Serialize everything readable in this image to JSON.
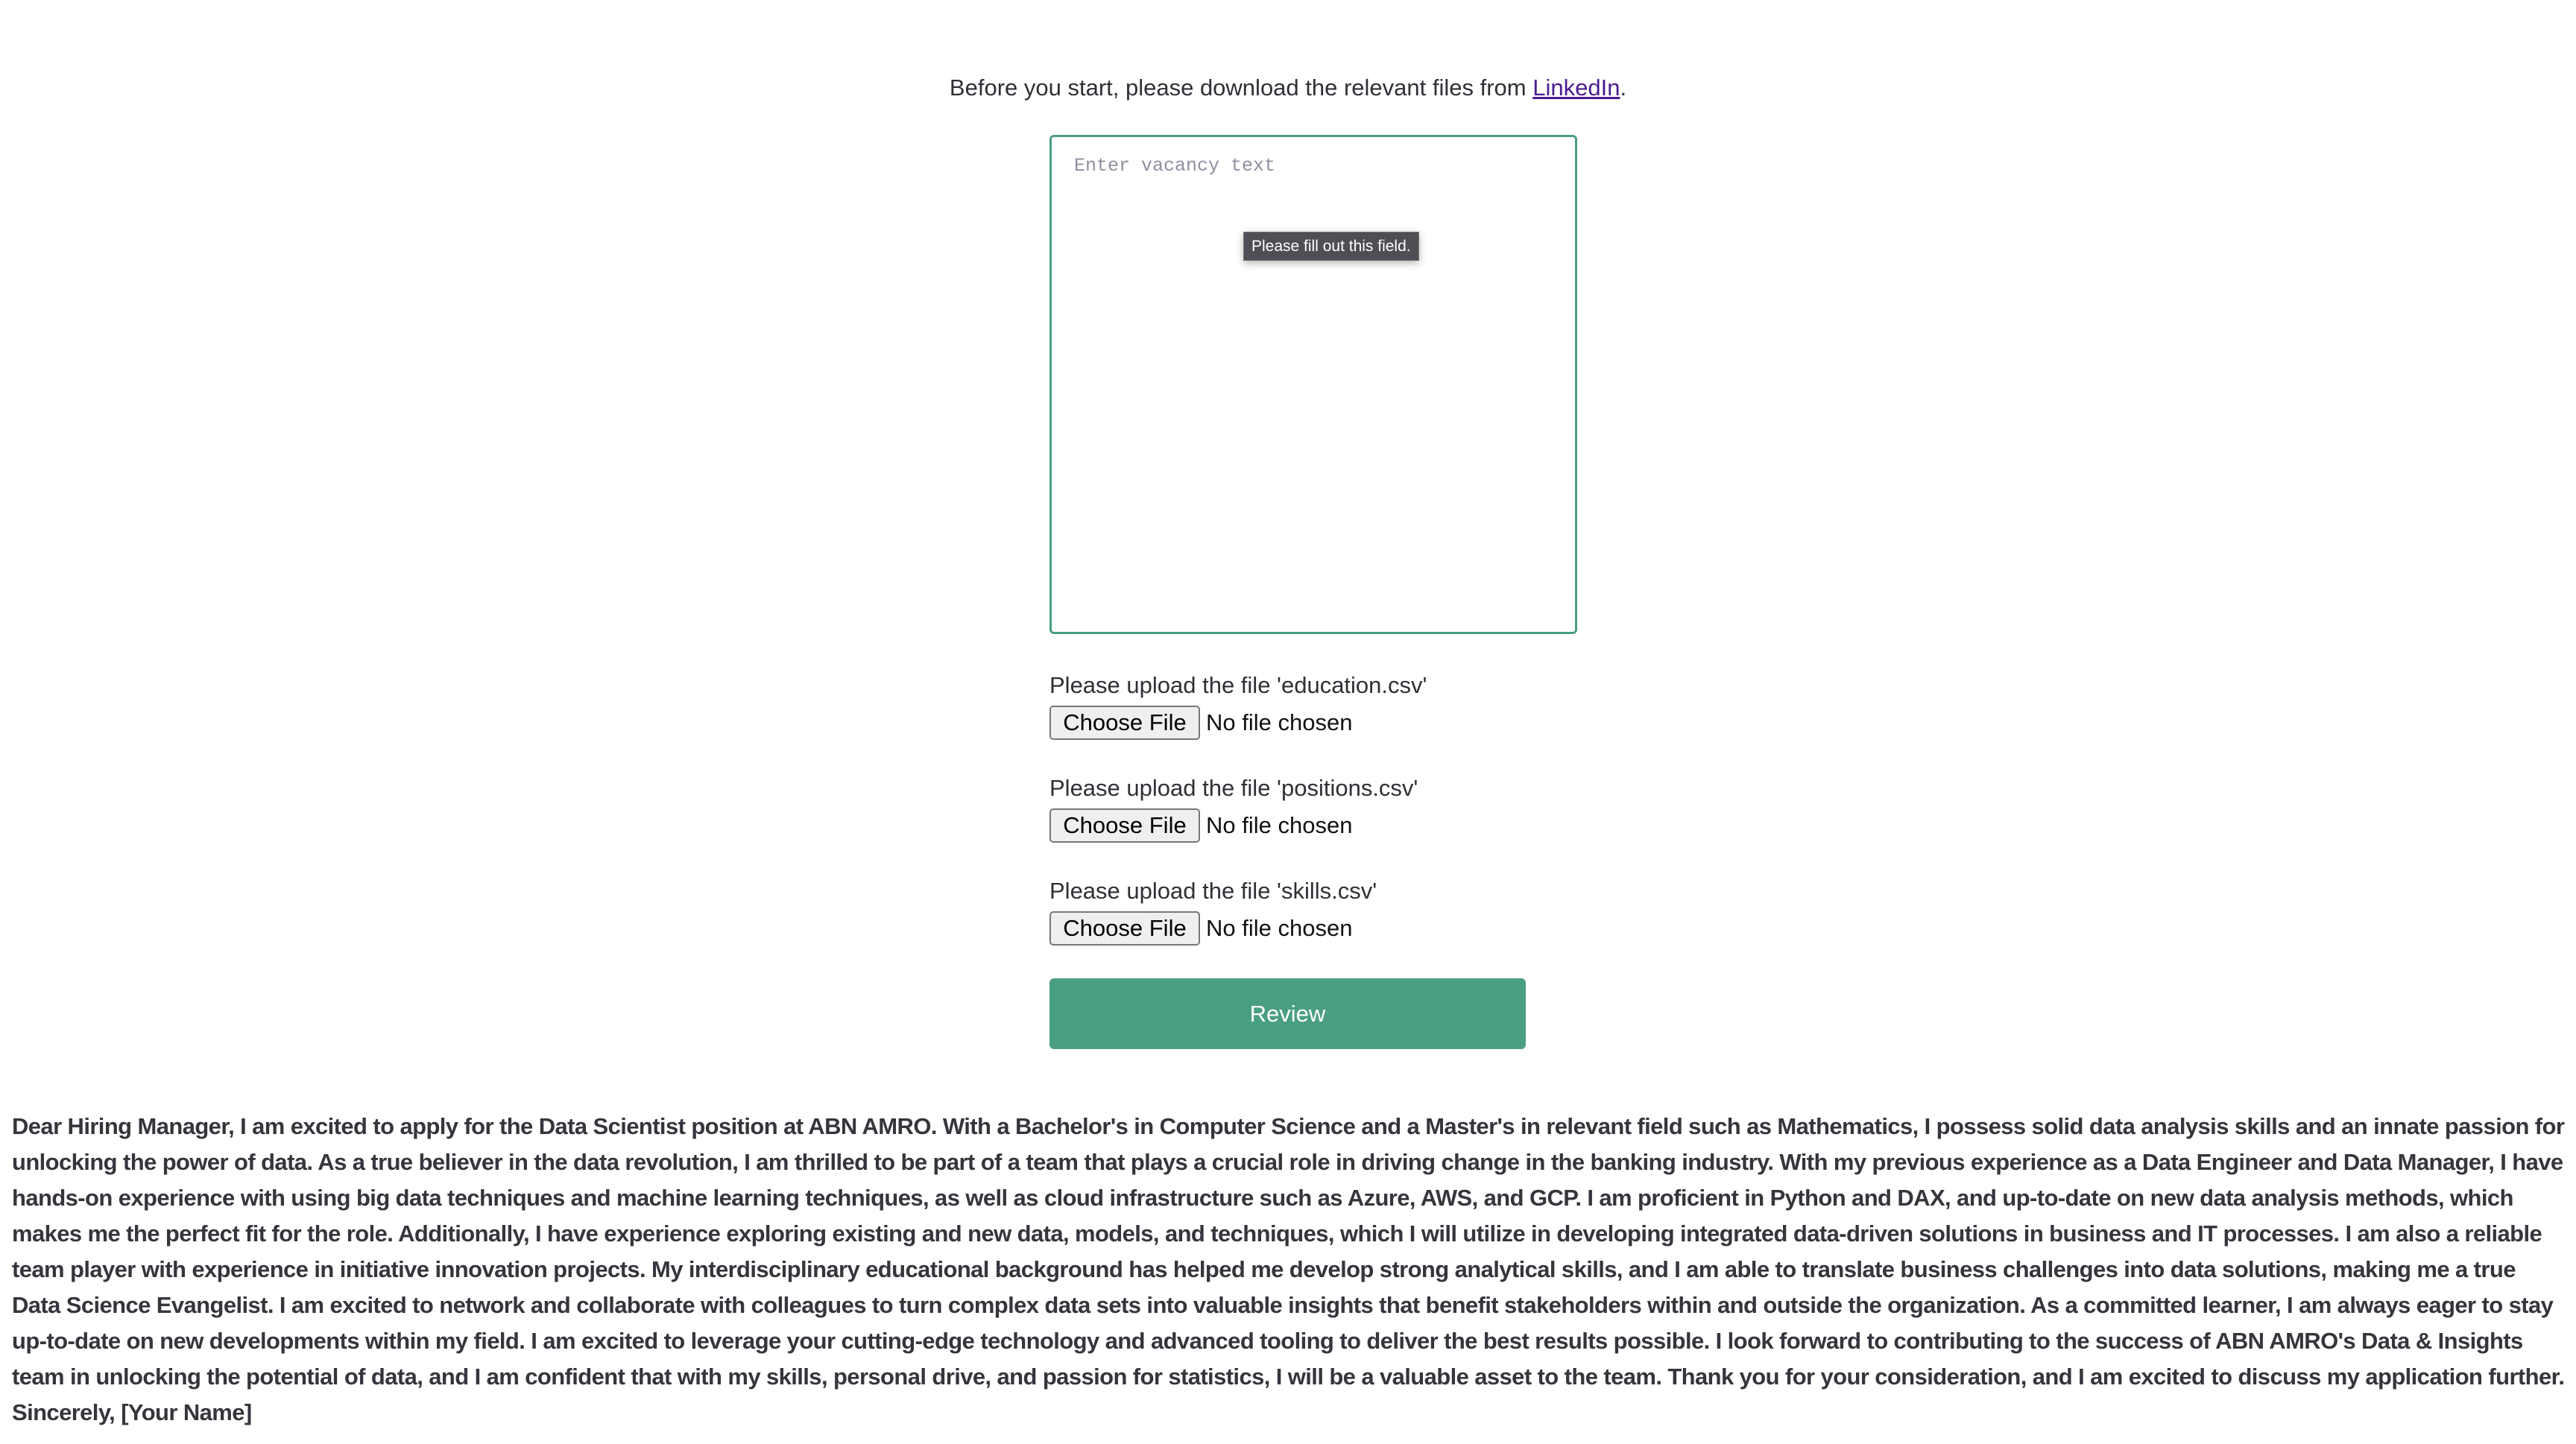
{
  "intro": {
    "text": "Before you start, please download the relevant files from ",
    "link": "LinkedIn",
    "suffix": "."
  },
  "vacancy": {
    "placeholder": "Enter vacancy text",
    "value": "",
    "tooltip": "Please fill out this field."
  },
  "uploads": [
    {
      "label": "Please upload the file 'education.csv'",
      "button": "Choose File",
      "status": "No file chosen"
    },
    {
      "label": "Please upload the file 'positions.csv'",
      "button": "Choose File",
      "status": "No file chosen"
    },
    {
      "label": "Please upload the file 'skills.csv'",
      "button": "Choose File",
      "status": "No file chosen"
    }
  ],
  "review_label": "Review",
  "letter": "Dear Hiring Manager, I am excited to apply for the Data Scientist position at ABN AMRO. With a Bachelor's in Computer Science and a Master's in relevant field such as Mathematics, I possess solid data analysis skills and an innate passion for unlocking the power of data. As a true believer in the data revolution, I am thrilled to be part of a team that plays a crucial role in driving change in the banking industry. With my previous experience as a Data Engineer and Data Manager, I have hands-on experience with using big data techniques and machine learning techniques, as well as cloud infrastructure such as Azure, AWS, and GCP. I am proficient in Python and DAX, and up-to-date on new data analysis methods, which makes me the perfect fit for the role. Additionally, I have experience exploring existing and new data, models, and techniques, which I will utilize in developing integrated data-driven solutions in business and IT processes. I am also a reliable team player with experience in initiative innovation projects. My interdisciplinary educational background has helped me develop strong analytical skills, and I am able to translate business challenges into data solutions, making me a true Data Science Evangelist. I am excited to network and collaborate with colleagues to turn complex data sets into valuable insights that benefit stakeholders within and outside the organization. As a committed learner, I am always eager to stay up-to-date on new developments within my field. I am excited to leverage your cutting-edge technology and advanced tooling to deliver the best results possible. I look forward to contributing to the success of ABN AMRO's Data & Insights team in unlocking the potential of data, and I am confident that with my skills, personal drive, and passion for statistics, I will be a valuable asset to the team. Thank you for your consideration, and I am excited to discuss my application further. Sincerely, [Your Name]",
  "colors": {
    "accent": "#4a9f80",
    "link": "#4b1d8f"
  }
}
